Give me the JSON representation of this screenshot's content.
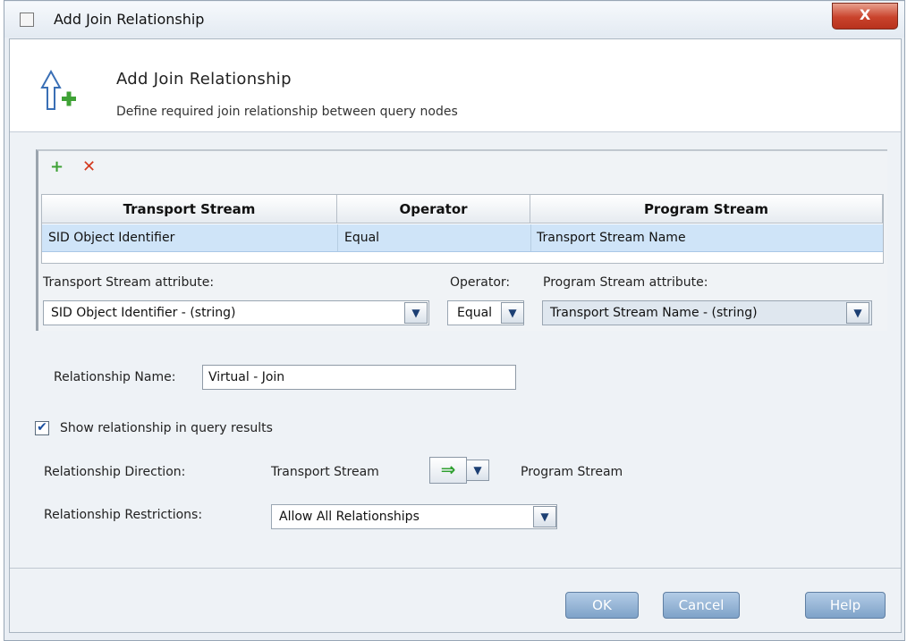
{
  "window": {
    "title": "Add Join Relationship",
    "close_label": "X"
  },
  "header": {
    "title": "Add Join Relationship",
    "subtitle": "Define required join relationship between query nodes"
  },
  "toolbar": {
    "add_icon": "+",
    "delete_icon": "✕"
  },
  "table": {
    "columns": [
      "Transport Stream",
      "Operator",
      "Program Stream"
    ],
    "rows": [
      [
        "SID Object Identifier",
        "Equal",
        "Transport Stream Name"
      ]
    ]
  },
  "attributes": {
    "left_label": "Transport Stream attribute:",
    "left_value": "SID Object Identifier - (string)",
    "operator_label": "Operator:",
    "operator_value": "Equal",
    "right_label": "Program Stream attribute:",
    "right_value": "Transport Stream Name - (string)"
  },
  "relationship_name": {
    "label": "Relationship Name:",
    "value": "Virtual - Join"
  },
  "show_in_results": {
    "label": "Show relationship in query results",
    "checked": true
  },
  "direction": {
    "label": "Relationship Direction:",
    "from": "Transport Stream",
    "to": "Program Stream",
    "arrow": "⇒"
  },
  "restrictions": {
    "label": "Relationship Restrictions:",
    "value": "Allow All Relationships"
  },
  "buttons": {
    "ok": "OK",
    "cancel": "Cancel",
    "help": "Help"
  },
  "colors": {
    "selection": "#cfe4f8",
    "accent": "#7ea2c8",
    "close": "#c9432c"
  }
}
